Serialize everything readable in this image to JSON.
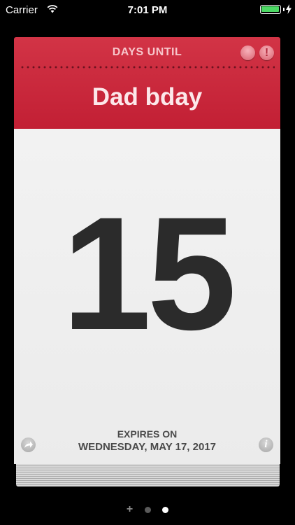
{
  "status_bar": {
    "carrier": "Carrier",
    "time": "7:01 PM",
    "battery_level": 1.0,
    "battery_color": "#4cd964"
  },
  "card": {
    "header_title": "DAYS UNTIL",
    "event_name": "Dad bday",
    "days_count": "15",
    "expires_label": "EXPIRES ON",
    "expires_date": "WEDNESDAY, MAY 17, 2017",
    "alert_glyph": "!",
    "info_glyph": "i",
    "header_color": "#c8283a",
    "icons": {
      "round_button": "circle-button-icon",
      "alert_button": "exclamation-icon",
      "share_button": "share-arrow-icon",
      "info_button": "info-icon"
    }
  },
  "pager": {
    "items": [
      "add",
      "page-1",
      "page-2"
    ],
    "active_index": 2,
    "add_glyph": "+"
  }
}
